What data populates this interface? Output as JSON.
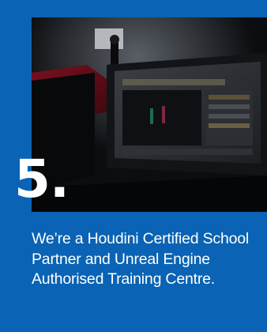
{
  "card": {
    "step_number": "5.",
    "caption": "We’re a Houdini Certified School Partner and Unreal Engine Authorised Training Centre."
  },
  "photo": {
    "subject": "classroom-monitor-photo"
  },
  "colors": {
    "card_background": "#0a63b4",
    "text": "#ffffff"
  }
}
